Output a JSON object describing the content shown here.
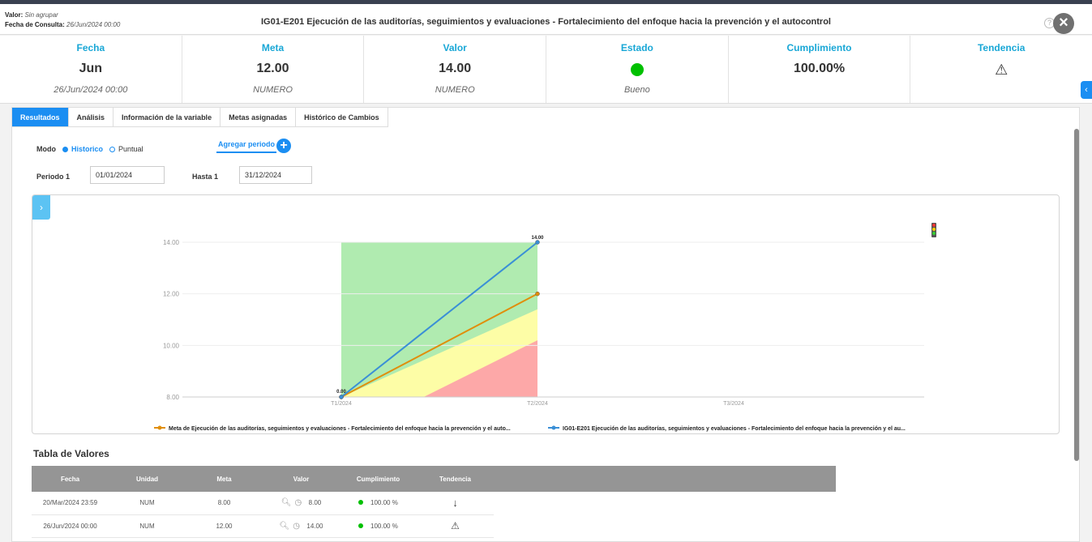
{
  "header": {
    "valor_label": "Valor:",
    "valor_value": "Sin agrupar",
    "fecha_label": "Fecha de Consulta:",
    "fecha_value": "26/Jun/2024 00:00",
    "title": "IG01-E201 Ejecución de las auditorías, seguimientos y evaluaciones - Fortalecimiento del enfoque hacia la prevención y el autocontrol",
    "help_icon": "help-circle-icon",
    "close_icon": "close-icon"
  },
  "summary": {
    "fecha": {
      "head": "Fecha",
      "main": "Jun",
      "sub": "26/Jun/2024 00:00"
    },
    "meta": {
      "head": "Meta",
      "main": "12.00",
      "sub": "NUMERO"
    },
    "valor": {
      "head": "Valor",
      "main": "14.00",
      "sub": "NUMERO"
    },
    "estado": {
      "head": "Estado",
      "sub": "Bueno",
      "color": "#00c000"
    },
    "cumplimiento": {
      "head": "Cumplimiento",
      "main": "100.00%"
    },
    "tendencia": {
      "head": "Tendencia",
      "icon": "warning-triangle-icon",
      "glyph": "⚠"
    }
  },
  "tabs": [
    "Resultados",
    "Análisis",
    "Información de la variable",
    "Metas asignadas",
    "Histórico de Cambios"
  ],
  "controls": {
    "mode_label": "Modo",
    "mode_options": [
      "Historico",
      "Puntual"
    ],
    "mode_selected": "Historico",
    "add_period": "Agregar periodo",
    "period_label": "Periodo 1",
    "period_value": "01/01/2024",
    "until_label": "Hasta 1",
    "until_value": "31/12/2024"
  },
  "colors": {
    "accent": "#1b8ef2",
    "meta_series": "#e08e0b",
    "valor_series": "#3a8fd6",
    "band_green": "#b0ebb0",
    "band_yellow": "#fdfda6",
    "band_red": "#fda8a8"
  },
  "chart_data": {
    "type": "line",
    "categories": [
      "T1/2024",
      "T2/2024",
      "T3/2024"
    ],
    "ylim": [
      8,
      14
    ],
    "yticks": [
      "8.00",
      "10.00",
      "12.00",
      "14.00"
    ],
    "series": [
      {
        "name": "Meta de Ejecución de las auditorías, seguimientos y evaluaciones - Fortalecimiento del enfoque hacia la prevención y el auto...",
        "values": [
          8,
          12
        ],
        "color": "#e08e0b"
      },
      {
        "name": "IG01-E201 Ejecución de las auditorías, seguimientos y evaluaciones - Fortalecimiento del enfoque hacia la prevención y el au...",
        "values": [
          8,
          14
        ],
        "color": "#3a8fd6"
      }
    ],
    "point_labels": [
      "0.00",
      "14.00"
    ],
    "bands": {
      "red_top": [
        6,
        10.2
      ],
      "yellow_top": [
        7,
        11.4
      ]
    },
    "legend_position": "bottom"
  },
  "table": {
    "title": "Tabla de Valores",
    "columns": [
      "Fecha",
      "Unidad",
      "Meta",
      "Valor",
      "Cumplimiento",
      "Tendencia"
    ],
    "rows": [
      {
        "fecha": "20/Mar/2024 23:59",
        "unidad": "NUM",
        "meta": "8.00",
        "valor": "8.00",
        "cumplimiento": "100.00 %",
        "tendencia": "↓",
        "tendencia_icon": "arrow-down-icon"
      },
      {
        "fecha": "26/Jun/2024 00:00",
        "unidad": "NUM",
        "meta": "12.00",
        "valor": "14.00",
        "cumplimiento": "100.00 %",
        "tendencia": "⚠",
        "tendencia_icon": "warning-triangle-icon"
      }
    ]
  }
}
